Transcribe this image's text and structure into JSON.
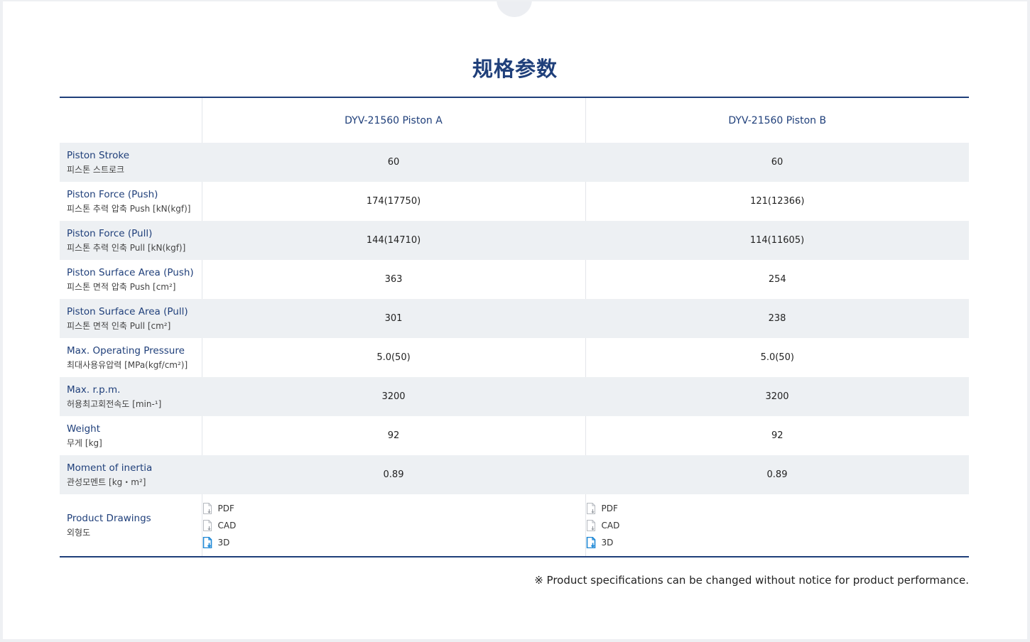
{
  "section": {
    "title": "规格参数"
  },
  "table": {
    "columns": [
      "DYV-21560 Piston A",
      "DYV-21560 Piston B"
    ],
    "rows": [
      {
        "label_en": "Piston Stroke",
        "label_ko": "피스톤 스트로크",
        "a": "60",
        "b": "60"
      },
      {
        "label_en": "Piston Force (Push)",
        "label_ko": "피스톤 추력 압축 Push [kN(kgf)]",
        "a": "174(17750)",
        "b": "121(12366)"
      },
      {
        "label_en": "Piston Force (Pull)",
        "label_ko": "피스톤 추력 인축 Pull [kN(kgf)]",
        "a": "144(14710)",
        "b": "114(11605)"
      },
      {
        "label_en": "Piston Surface Area (Push)",
        "label_ko": "피스톤 면적 압축 Push [cm²]",
        "a": "363",
        "b": "254"
      },
      {
        "label_en": "Piston Surface Area (Pull)",
        "label_ko": "피스톤 면적 인축 Pull [cm²]",
        "a": "301",
        "b": "238"
      },
      {
        "label_en": "Max. Operating Pressure",
        "label_ko": "최대사용유압력 [MPa(kgf/cm²)]",
        "a": "5.0(50)",
        "b": "5.0(50)"
      },
      {
        "label_en": "Max. r.p.m.",
        "label_ko": "허용최고회전속도 [min-¹]",
        "a": "3200",
        "b": "3200"
      },
      {
        "label_en": "Weight",
        "label_ko": "무게 [kg]",
        "a": "92",
        "b": "92"
      },
      {
        "label_en": "Moment of inertia",
        "label_ko": "관성모멘트 [kg・m²]",
        "a": "0.89",
        "b": "0.89"
      }
    ],
    "drawings": {
      "label_en": "Product Drawings",
      "label_ko": "외형도",
      "files": [
        "PDF",
        "CAD",
        "3D"
      ]
    }
  },
  "icons": {
    "file_download": "file-download-icon",
    "file_3d_download": "file-3d-download-icon"
  },
  "colors": {
    "title": "#1f3f7a",
    "row_shade": "#edf0f3",
    "icon_gray": "#b5b9bf",
    "icon_blue": "#1e88d6"
  },
  "notice": "※ Product specifications can be changed without notice for product performance."
}
